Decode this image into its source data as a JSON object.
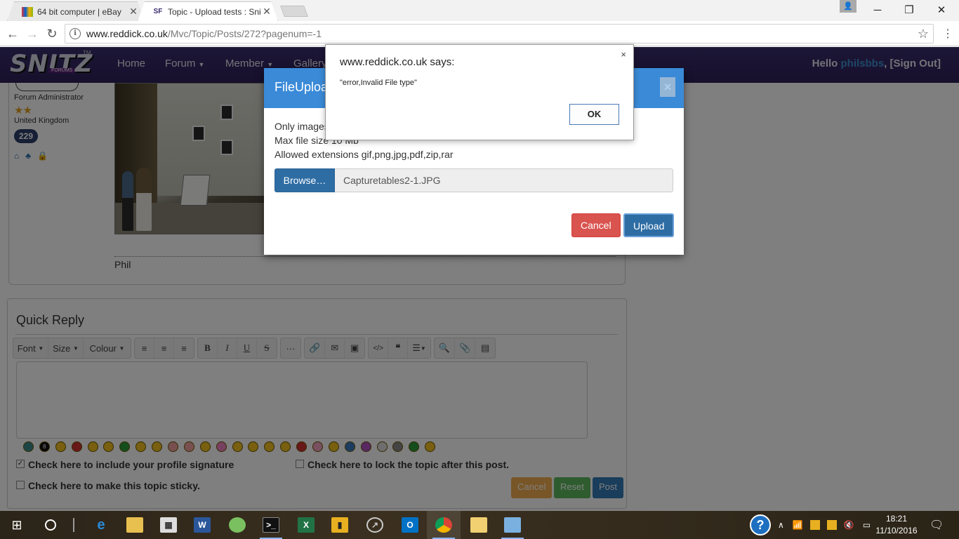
{
  "browser": {
    "tabs": [
      {
        "label": "64 bit computer | eBay",
        "favicon": "ebay-favicon",
        "active": false
      },
      {
        "label": "Topic - Upload tests : Sni",
        "favicon": "snitz-favicon",
        "active": true
      }
    ],
    "url_host": "www.reddick.co.uk",
    "url_path": "/Mvc/Topic/Posts/272?pagenum=-1"
  },
  "site": {
    "logo": "SNITZ",
    "logo_sub": "FORUMS",
    "logo_tm": "TM",
    "nav": [
      "Home",
      "Forum",
      "Member",
      "Gallery"
    ],
    "hello_prefix": "Hello ",
    "username": "philsbbs",
    "signout": ", [Sign Out]"
  },
  "post": {
    "role": "Forum Administrator",
    "country": "United Kingdom",
    "post_count": "229",
    "signature": "Phil"
  },
  "quick_reply": {
    "title": "Quick Reply",
    "toolbar_dropdowns": [
      "Font",
      "Size",
      "Colour"
    ],
    "sig_label": "Check here to include your profile signature",
    "lock_label": "Check here to lock the topic after this post.",
    "sticky_label": "Check here to make this topic sticky.",
    "sig_checked": true,
    "buttons": {
      "cancel": "Cancel",
      "reset": "Reset",
      "post": "Post"
    }
  },
  "upload_modal": {
    "title": "FileUpload",
    "line1": "Only images",
    "line2": "Max file size 10 Mb",
    "line3": "Allowed extensions gif,png,jpg,pdf,zip,rar",
    "browse": "Browse…",
    "filename": "Capturetables2-1.JPG",
    "cancel": "Cancel",
    "upload": "Upload",
    "close": "×"
  },
  "alert": {
    "title": "www.reddick.co.uk says:",
    "message": "\"error,Invalid File type\"",
    "ok": "OK",
    "close": "×"
  },
  "taskbar": {
    "time": "18:21",
    "date": "11/10/2016"
  },
  "colors": {
    "header": "#3a2d6e",
    "modal_head": "#3a8ad8",
    "primary": "#2e6da4",
    "danger": "#d9534f",
    "warning": "#f0ad4e",
    "success": "#5cb85c"
  }
}
